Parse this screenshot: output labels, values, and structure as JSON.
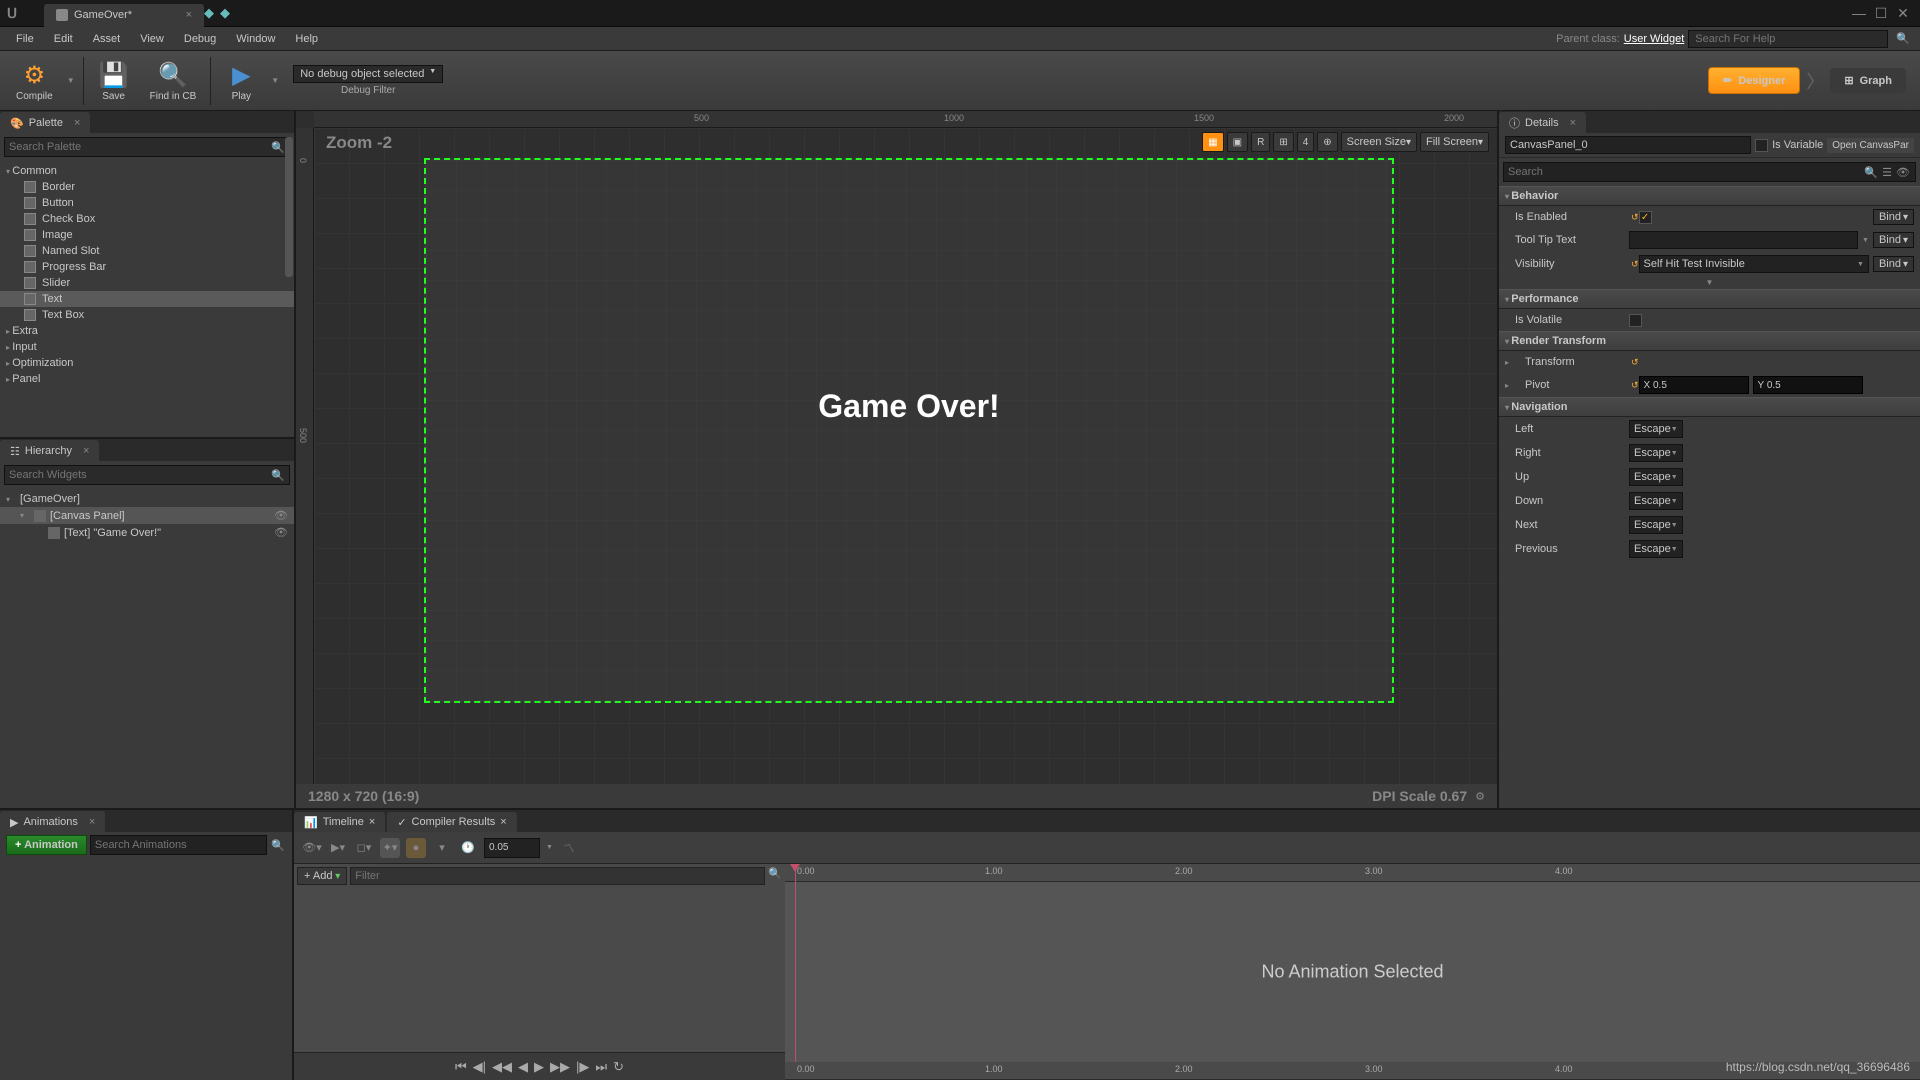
{
  "window": {
    "title": "GameOver*"
  },
  "menu": {
    "items": [
      "File",
      "Edit",
      "Asset",
      "View",
      "Debug",
      "Window",
      "Help"
    ],
    "parent_class_label": "Parent class:",
    "parent_class": "User Widget",
    "help_search_placeholder": "Search For Help"
  },
  "toolbar": {
    "compile": "Compile",
    "save": "Save",
    "find": "Find in CB",
    "play": "Play",
    "debug_select": "No debug object selected",
    "debug_label": "Debug Filter",
    "designer": "Designer",
    "graph": "Graph"
  },
  "palette": {
    "title": "Palette",
    "search_placeholder": "Search Palette",
    "categories": [
      {
        "name": "Common",
        "items": [
          "Border",
          "Button",
          "Check Box",
          "Image",
          "Named Slot",
          "Progress Bar",
          "Slider",
          "Text",
          "Text Box"
        ],
        "open": true
      },
      {
        "name": "Extra",
        "open": false
      },
      {
        "name": "Input",
        "open": false
      },
      {
        "name": "Optimization",
        "open": false
      },
      {
        "name": "Panel",
        "open": false
      }
    ],
    "selected": "Text"
  },
  "hierarchy": {
    "title": "Hierarchy",
    "search_placeholder": "Search Widgets",
    "root": "[GameOver]",
    "canvas": "[Canvas Panel]",
    "text": "[Text] \"Game Over!\""
  },
  "viewport": {
    "zoom": "Zoom -2",
    "ruler_h": [
      "500",
      "1000",
      "1500",
      "2000"
    ],
    "ruler_v": [
      "0",
      "500"
    ],
    "controls": {
      "r": "R",
      "grid": "4",
      "screen": "Screen Size",
      "fill": "Fill Screen"
    },
    "canvas_text": "Game Over!",
    "resolution": "1280 x 720 (16:9)",
    "dpi": "DPI Scale 0.67"
  },
  "details": {
    "title": "Details",
    "name": "CanvasPanel_0",
    "is_variable": "Is Variable",
    "open": "Open CanvasPar",
    "search_placeholder": "Search",
    "behavior": {
      "header": "Behavior",
      "is_enabled": "Is Enabled",
      "tooltip": "Tool Tip Text",
      "visibility": "Visibility",
      "visibility_val": "Self Hit Test Invisible",
      "bind": "Bind"
    },
    "performance": {
      "header": "Performance",
      "volatile": "Is Volatile"
    },
    "render": {
      "header": "Render Transform",
      "transform": "Transform",
      "pivot": "Pivot",
      "px": "X 0.5",
      "py": "Y 0.5"
    },
    "nav": {
      "header": "Navigation",
      "left": "Left",
      "right": "Right",
      "up": "Up",
      "down": "Down",
      "next": "Next",
      "prev": "Previous",
      "escape": "Escape"
    }
  },
  "animations": {
    "title": "Animations",
    "add": "Animation",
    "search_placeholder": "Search Animations"
  },
  "timeline": {
    "title": "Timeline",
    "compiler": "Compiler Results",
    "time": "0.05",
    "add": "+ Add",
    "filter_placeholder": "Filter",
    "ticks": [
      "0.00",
      "1.00",
      "2.00",
      "3.00",
      "4.00"
    ],
    "no_anim": "No Animation Selected",
    "end": "0.00"
  },
  "watermark": "https://blog.csdn.net/qq_36696486"
}
